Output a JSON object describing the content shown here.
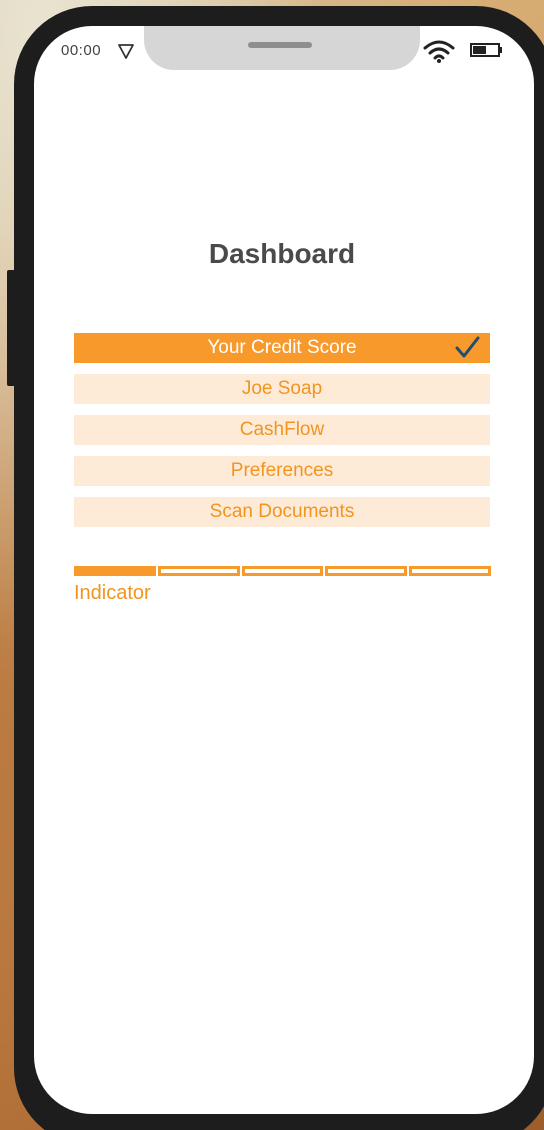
{
  "status_bar": {
    "time": "00:00"
  },
  "header": {
    "title": "Dashboard"
  },
  "menu": {
    "items": [
      {
        "label": "Your Credit Score",
        "active": true
      },
      {
        "label": "Joe Soap",
        "active": false
      },
      {
        "label": "CashFlow",
        "active": false
      },
      {
        "label": "Preferences",
        "active": false
      },
      {
        "label": "Scan Documents",
        "active": false
      }
    ]
  },
  "indicator": {
    "label": "Indicator",
    "segments_total": 5,
    "segments_filled": 1
  },
  "colors": {
    "accent": "#f7992b",
    "item_background": "#fdebd8",
    "check": "#1f4e6e",
    "title_text": "#4a4a4a"
  },
  "icons": {
    "check": "checkmark-icon",
    "location": "location-arrow-icon",
    "wifi": "wifi-icon",
    "battery": "battery-icon"
  }
}
